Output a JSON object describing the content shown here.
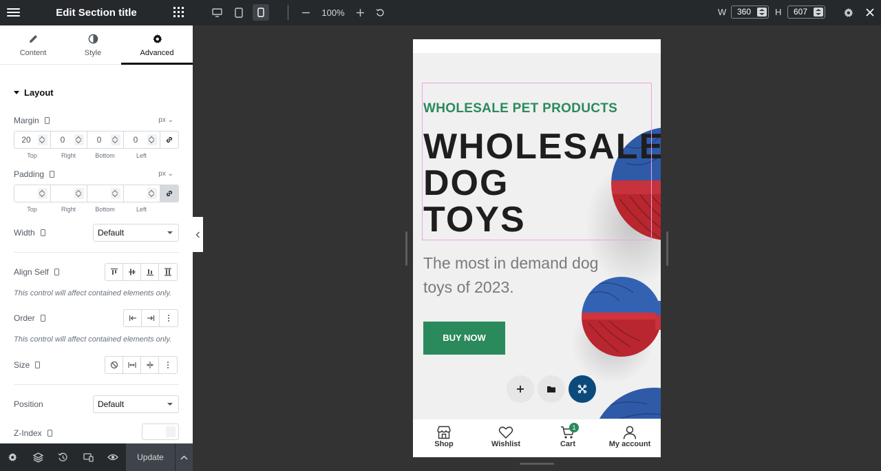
{
  "topbar": {
    "title": "Edit Section title",
    "zoom": "100%",
    "width_label": "W",
    "width_value": "360",
    "height_label": "H",
    "height_value": "607"
  },
  "panel": {
    "tabs": [
      {
        "label": "Content",
        "icon": "pencil-icon"
      },
      {
        "label": "Style",
        "icon": "half-circle-icon"
      },
      {
        "label": "Advanced",
        "icon": "gear-icon",
        "active": true
      }
    ],
    "section_title": "Layout",
    "margin": {
      "label": "Margin",
      "unit": "px",
      "values": [
        "20",
        "0",
        "0",
        "0"
      ],
      "sides": [
        "Top",
        "Right",
        "Bottom",
        "Left"
      ]
    },
    "padding": {
      "label": "Padding",
      "unit": "px",
      "values": [
        "",
        "",
        "",
        ""
      ],
      "sides": [
        "Top",
        "Right",
        "Bottom",
        "Left"
      ]
    },
    "width": {
      "label": "Width",
      "value": "Default"
    },
    "align_self": {
      "label": "Align Self",
      "note": "This control will affect contained elements only."
    },
    "order": {
      "label": "Order",
      "note": "This control will affect contained elements only."
    },
    "size": {
      "label": "Size"
    },
    "position": {
      "label": "Position",
      "value": "Default"
    },
    "zindex": {
      "label": "Z-Index"
    }
  },
  "bottombar": {
    "update_label": "Update"
  },
  "preview": {
    "eyebrow": "WHOLESALE PET PRODUCTS",
    "headline": [
      "WHOLESALE",
      "DOG",
      "TOYS"
    ],
    "subtitle": "The most in demand dog toys of 2023.",
    "button": "BUY NOW",
    "nav": [
      {
        "label": "Shop",
        "icon": "shop-icon"
      },
      {
        "label": "Wishlist",
        "icon": "heart-icon"
      },
      {
        "label": "Cart",
        "icon": "cart-icon",
        "badge": "1"
      },
      {
        "label": "My account",
        "icon": "user-icon"
      }
    ]
  },
  "colors": {
    "brand_green": "#2a8a5c",
    "editor_dark": "#26292c",
    "fab_blue": "#0c4a7c"
  }
}
